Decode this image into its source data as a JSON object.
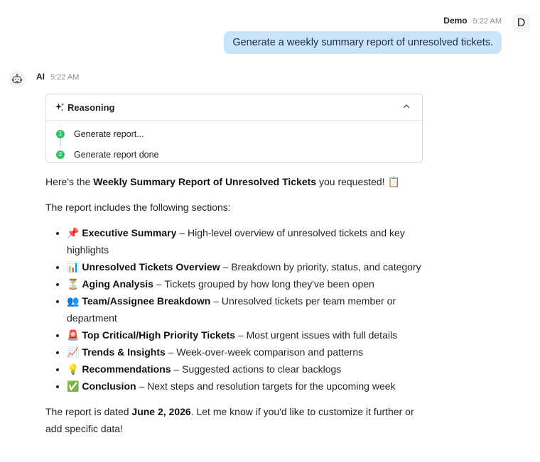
{
  "user": {
    "name": "Demo",
    "time": "5:22 AM",
    "avatar_initial": "D",
    "message": "Generate a weekly summary report of unresolved tickets."
  },
  "ai": {
    "name": "AI",
    "time": "5:22 AM",
    "avatar_icon": "robot-icon"
  },
  "reasoning": {
    "title": "Reasoning",
    "icon": "sparkles-icon",
    "collapse_icon": "chevron-up-icon",
    "steps": [
      {
        "num": "1",
        "label": "Generate report..."
      },
      {
        "num": "2",
        "label": "Generate report done"
      }
    ]
  },
  "response": {
    "intro_pre": "Here's the ",
    "intro_bold": "Weekly Summary Report of Unresolved Tickets",
    "intro_post": " you requested! 📋",
    "sections_intro": "The report includes the following sections:",
    "sections": [
      {
        "emoji": "📌",
        "title": "Executive Summary",
        "desc": " – High-level overview of unresolved tickets and key highlights"
      },
      {
        "emoji": "📊",
        "title": "Unresolved Tickets Overview",
        "desc": " – Breakdown by priority, status, and category"
      },
      {
        "emoji": "⏳",
        "title": "Aging Analysis",
        "desc": " – Tickets grouped by how long they've been open"
      },
      {
        "emoji": "👥",
        "title": "Team/Assignee Breakdown",
        "desc": " – Unresolved tickets per team member or department"
      },
      {
        "emoji": "🚨",
        "title": "Top Critical/High Priority Tickets",
        "desc": " – Most urgent issues with full details"
      },
      {
        "emoji": "📈",
        "title": "Trends & Insights",
        "desc": " – Week-over-week comparison and patterns"
      },
      {
        "emoji": "💡",
        "title": "Recommendations",
        "desc": " – Suggested actions to clear backlogs"
      },
      {
        "emoji": "✅",
        "title": "Conclusion",
        "desc": " – Next steps and resolution targets for the upcoming week"
      }
    ],
    "closing_pre": "The report is dated ",
    "closing_bold": "June 2, 2026",
    "closing_post": ". Let me know if you'd like to customize it further or add specific data!"
  }
}
